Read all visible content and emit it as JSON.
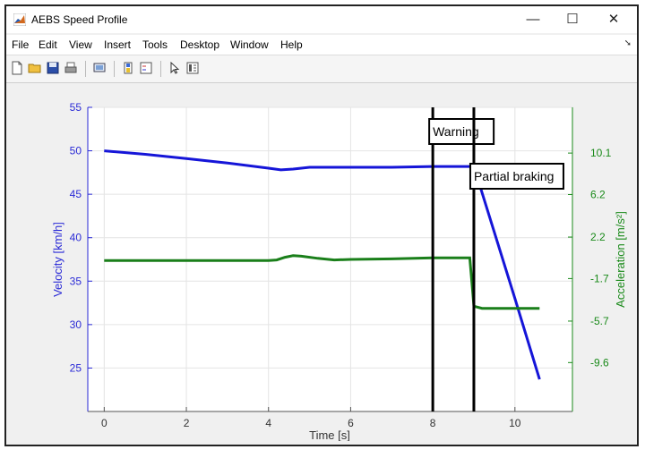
{
  "window": {
    "title": "AEBS Speed Profile",
    "controls": {
      "minimize": "—",
      "maximize": "☐",
      "close": "✕"
    }
  },
  "menu": [
    "File",
    "Edit",
    "View",
    "Insert",
    "Tools",
    "Desktop",
    "Window",
    "Help"
  ],
  "toolbar": [
    "new-file-icon",
    "open-folder-icon",
    "save-icon",
    "print-icon",
    "link-plot-icon",
    "colorbar-icon",
    "legend-icon",
    "pointer-icon",
    "property-editor-icon"
  ],
  "chart_data": {
    "type": "line",
    "xlabel": "Time [s]",
    "ylabel_left": "Velocity [km/h]",
    "ylabel_right": "Acceleration [m/s²]",
    "xlim": [
      -0.4,
      11.4
    ],
    "ylim_left": [
      20,
      55
    ],
    "ylim_right": [
      -14.2,
      14.4
    ],
    "x_ticks": [
      "0",
      "2",
      "4",
      "6",
      "8",
      "10"
    ],
    "y_ticks_left": [
      "25",
      "30",
      "35",
      "40",
      "45",
      "50",
      "55"
    ],
    "y_ticks_right": [
      "10.1",
      "6.2",
      "2.2",
      "-1.7",
      "-5.7",
      "-9.6"
    ],
    "right_tick_values": [
      10.1,
      6.2,
      2.2,
      -1.7,
      -5.7,
      -9.6
    ],
    "grid": true,
    "colors": {
      "velocity": "#1515d8",
      "acceleration": "#1a7f1a",
      "left_axis": "#2a2ad6",
      "right_axis": "#1a8a1a"
    },
    "series": [
      {
        "name": "Velocity",
        "axis": "left",
        "x": [
          0,
          1,
          2,
          3,
          4,
          4.3,
          4.6,
          5,
          6,
          7,
          8,
          8.5,
          9,
          10,
          10.6
        ],
        "y": [
          50,
          49.6,
          49.1,
          48.6,
          48.0,
          47.8,
          47.9,
          48.1,
          48.1,
          48.1,
          48.2,
          48.2,
          48.2,
          33,
          23.7
        ]
      },
      {
        "name": "Acceleration",
        "axis": "right",
        "x": [
          0,
          1,
          2,
          3,
          4,
          4.2,
          4.4,
          4.6,
          4.8,
          5.2,
          5.6,
          6,
          7,
          8,
          8.9,
          8.95,
          9.0,
          9.2,
          10,
          10.6
        ],
        "y": [
          0.0,
          0.0,
          0.0,
          0.0,
          0.0,
          0.05,
          0.3,
          0.45,
          0.4,
          0.2,
          0.05,
          0.1,
          0.15,
          0.25,
          0.25,
          -2.0,
          -4.3,
          -4.5,
          -4.5,
          -4.5
        ]
      }
    ],
    "markers": [
      {
        "x": 8.0,
        "label": "Warning"
      },
      {
        "x": 9.0,
        "label": "Partial braking"
      }
    ]
  }
}
